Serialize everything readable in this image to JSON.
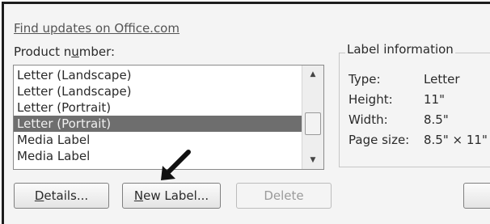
{
  "link": {
    "text": "Find updates on Office.com"
  },
  "product_number": {
    "label_pre": "Product n",
    "label_key": "u",
    "label_post": "mber:",
    "items": [
      {
        "label": "Letter (Landscape)",
        "selected": false
      },
      {
        "label": "Letter (Landscape)",
        "selected": false
      },
      {
        "label": "Letter (Portrait)",
        "selected": false
      },
      {
        "label": "Letter (Portrait)",
        "selected": true
      },
      {
        "label": "Media Label",
        "selected": false
      },
      {
        "label": "Media Label",
        "selected": false
      }
    ]
  },
  "label_information": {
    "title": "Label information",
    "rows": [
      {
        "key": "Type:",
        "value": "Letter"
      },
      {
        "key": "Height:",
        "value": "11\""
      },
      {
        "key": "Width:",
        "value": "8.5\""
      },
      {
        "key": "Page size:",
        "value": "8.5\" × 11\""
      }
    ]
  },
  "buttons": {
    "details": {
      "key": "D",
      "rest": "etails..."
    },
    "new_label": {
      "key": "N",
      "rest": "ew Label..."
    },
    "delete": {
      "label": "Delete"
    }
  },
  "icons": {
    "scroll_up": "▲",
    "scroll_down": "▼"
  }
}
